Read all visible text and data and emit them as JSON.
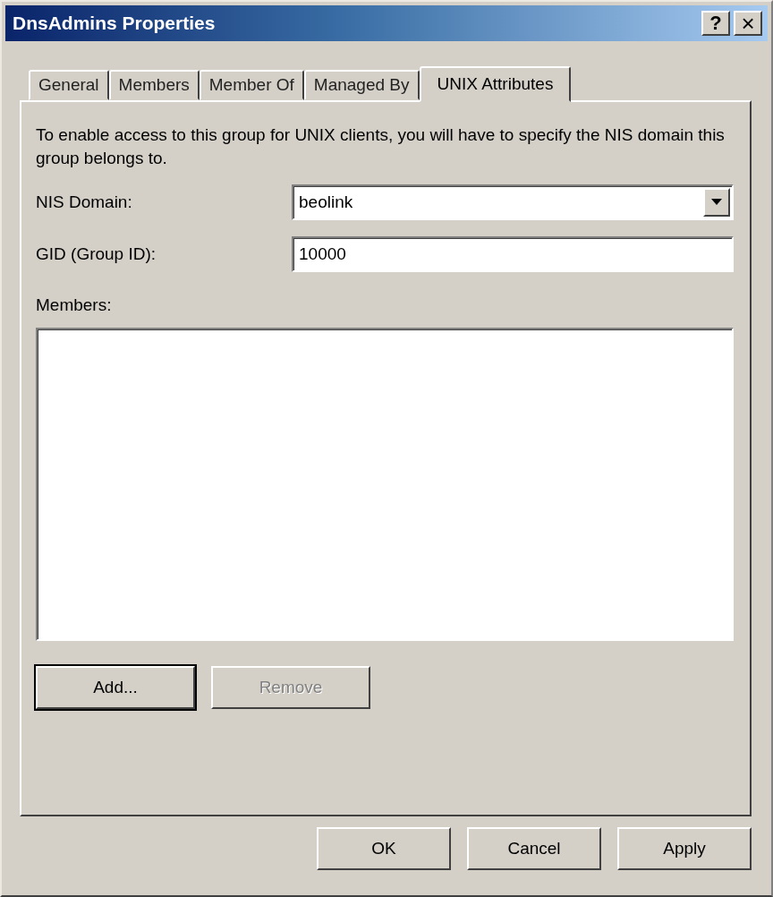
{
  "window": {
    "title": "DnsAdmins Properties",
    "controls": [
      {
        "kind": "help",
        "label": "?"
      },
      {
        "kind": "close",
        "label": "×"
      }
    ]
  },
  "tabs": [
    {
      "label": "General",
      "selected": false
    },
    {
      "label": "Members",
      "selected": false
    },
    {
      "label": "Member Of",
      "selected": false
    },
    {
      "label": "Managed By",
      "selected": false
    },
    {
      "label": "UNIX Attributes",
      "selected": true
    }
  ],
  "description": "To enable access to this group for UNIX clients, you will have to specify the NIS domain this group belongs to.",
  "nis_domain": {
    "label": "NIS Domain:",
    "value": "beolink"
  },
  "gid": {
    "label": "GID (Group ID):",
    "value": "10000"
  },
  "members": {
    "label": "Members:",
    "buttons": [
      {
        "label": "Add...",
        "disabled": false,
        "default": true
      },
      {
        "label": "Remove",
        "disabled": true,
        "default": false
      }
    ]
  },
  "buttons": [
    {
      "label": "OK",
      "disabled": false
    },
    {
      "label": "Cancel",
      "disabled": false
    },
    {
      "label": "Apply",
      "disabled": false
    }
  ]
}
